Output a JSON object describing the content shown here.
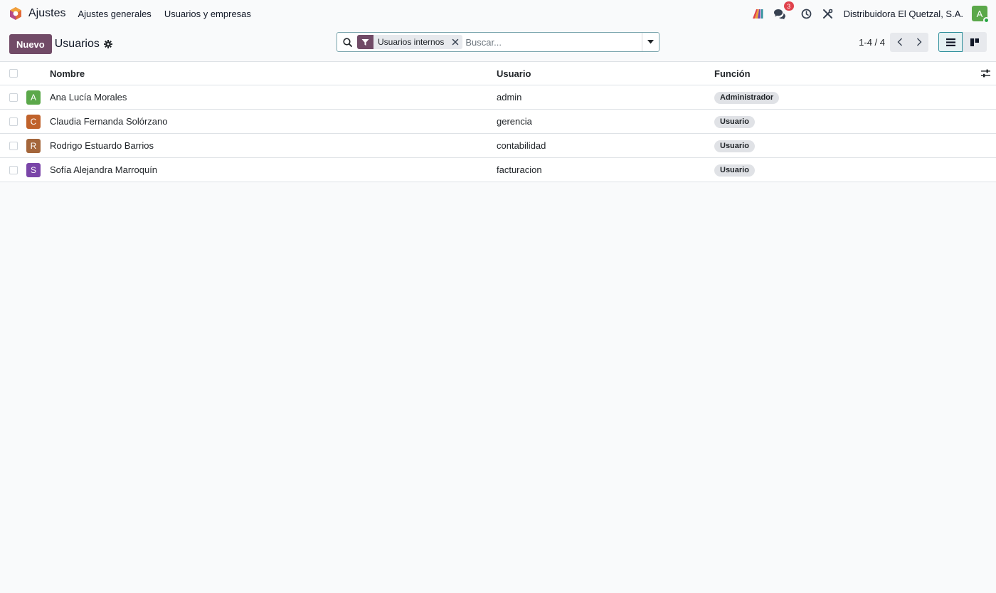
{
  "navbar": {
    "app_name": "Ajustes",
    "menu": [
      "Ajustes generales",
      "Usuarios y empresas"
    ],
    "chat_badge": "3",
    "company": "Distribuidora El Quetzal, S.A.",
    "user_initial": "A"
  },
  "control_panel": {
    "new_button": "Nuevo",
    "title": "Usuarios",
    "facet_label": "Usuarios internos",
    "search_placeholder": "Buscar...",
    "pager_value": "1-4 / 4"
  },
  "list": {
    "columns": {
      "name": "Nombre",
      "login": "Usuario",
      "role": "Función"
    },
    "rows": [
      {
        "initial": "A",
        "avatar_color": "#5ba84a",
        "name": "Ana Lucía Morales",
        "login": "admin",
        "role": "Administrador"
      },
      {
        "initial": "C",
        "avatar_color": "#c0622b",
        "name": "Claudia Fernanda Solórzano",
        "login": "gerencia",
        "role": "Usuario"
      },
      {
        "initial": "R",
        "avatar_color": "#a4663b",
        "name": "Rodrigo Estuardo Barrios",
        "login": "contabilidad",
        "role": "Usuario"
      },
      {
        "initial": "S",
        "avatar_color": "#7a45a8",
        "name": "Sofía Alejandra Marroquín",
        "login": "facturacion",
        "role": "Usuario"
      }
    ]
  },
  "colors": {
    "brand": "#714b67",
    "accent": "#2c8e9a",
    "badge_red": "#e0424c"
  }
}
